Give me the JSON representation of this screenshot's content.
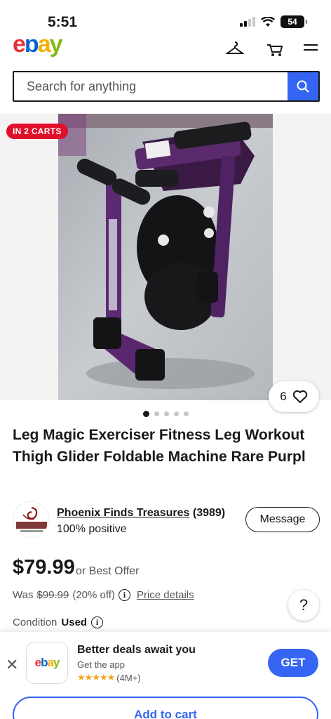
{
  "status_bar": {
    "time": "5:51",
    "battery": "54"
  },
  "header": {
    "logo_letters": [
      "e",
      "b",
      "a",
      "y"
    ],
    "icons": [
      "hanger-icon",
      "cart-icon",
      "menu-icon"
    ]
  },
  "search": {
    "placeholder": "Search for anything",
    "button_icon": "search-icon"
  },
  "listing": {
    "cart_badge": "IN 2 CARTS",
    "watch_count": "6",
    "image_count": 5,
    "active_image": 1,
    "title": "Leg Magic Exerciser Fitness Leg Workout Thigh Glider Foldable Machine Rare Purpl",
    "seller": {
      "name": "Phoenix Finds Treasures",
      "feedback": "(3989)",
      "positive": "100% positive",
      "message_label": "Message"
    },
    "price": "$79.99",
    "best_offer": "or Best Offer",
    "was_label": "Was",
    "was_price": "$99.99",
    "discount": "(20% off)",
    "price_details": "Price details",
    "condition_label": "Condition",
    "condition_value": "Used"
  },
  "help": {
    "label": "?"
  },
  "app_banner": {
    "logo_letters": [
      "e",
      "b",
      "a",
      "y"
    ],
    "title": "Better deals await you",
    "subtitle": "Get the app",
    "stars": "★★★★★",
    "rating": "(4M+)",
    "get_label": "GET",
    "close_label": "✕"
  },
  "add_to_cart": "Add to cart",
  "colors": {
    "accent": "#3665f3",
    "badge": "#e0102b",
    "logo_e": "#e53238",
    "logo_b": "#0064d2",
    "logo_a": "#f5af02",
    "logo_y": "#86b817"
  }
}
